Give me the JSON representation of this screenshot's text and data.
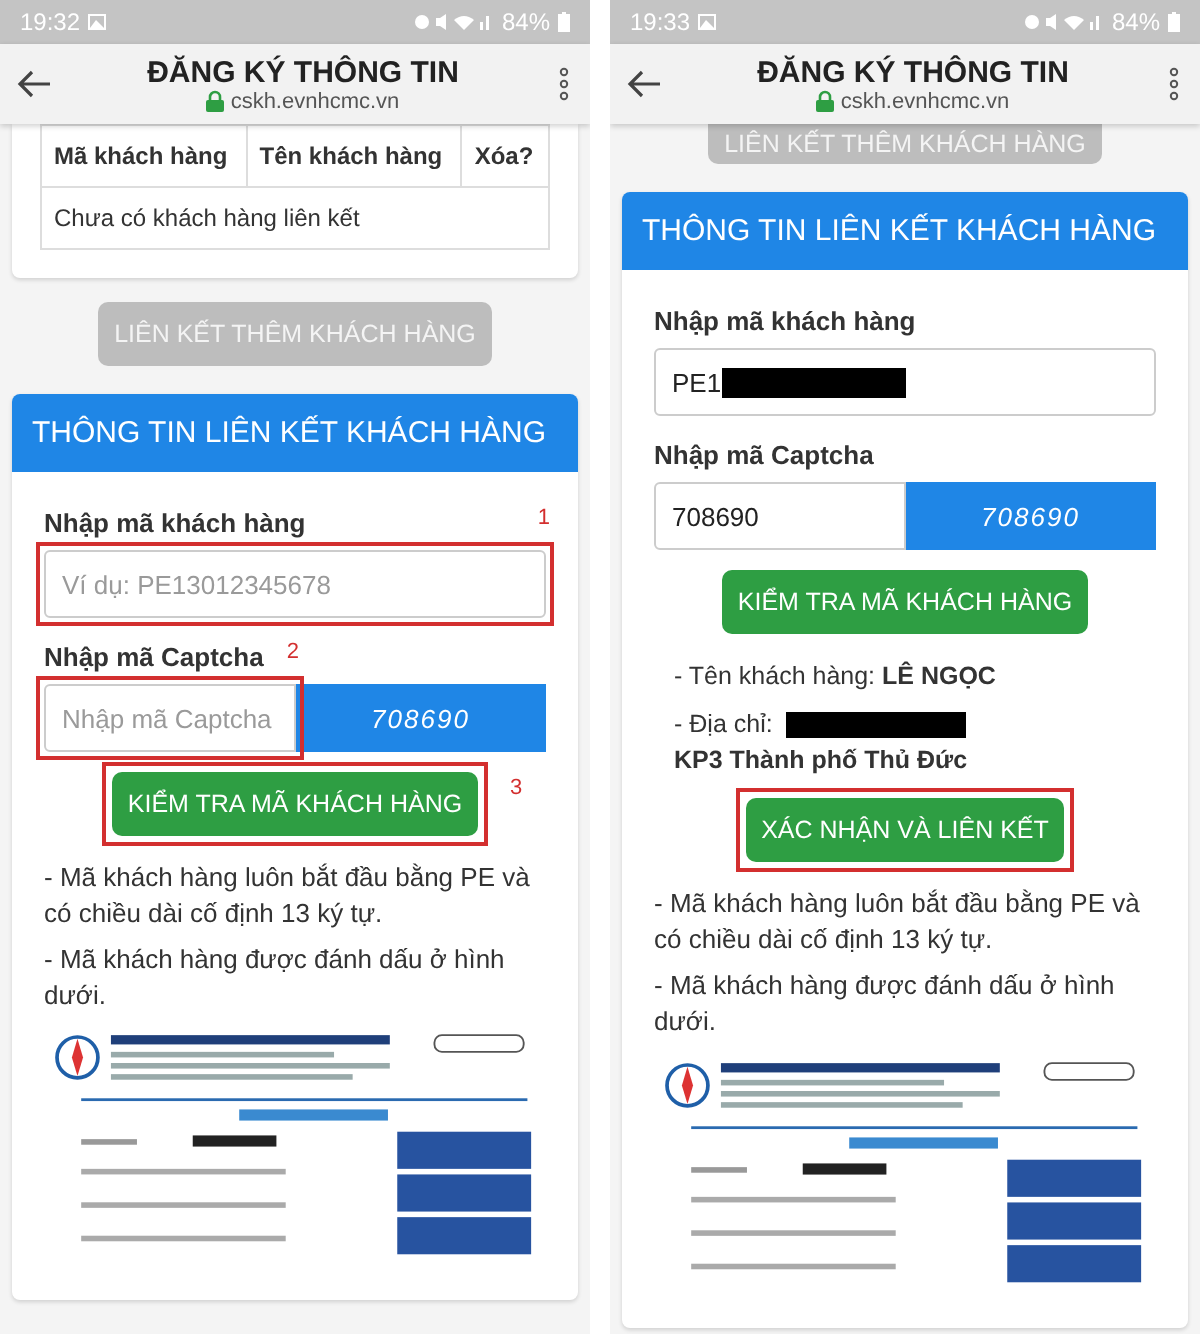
{
  "phones": [
    {
      "status_bar": {
        "time": "19:32",
        "battery": "84%"
      },
      "app_bar": {
        "title": "ĐĂNG KÝ THÔNG TIN",
        "url": "cskh.evnhcmc.vn"
      },
      "sections": [
        {
          "kind": "table",
          "columns": [
            "Mã khách hàng",
            "Tên khách hàng",
            "Xóa?"
          ],
          "empty_text": "Chưa có khách hàng liên kết"
        },
        {
          "kind": "button",
          "label": "LIÊN KẾT THÊM KHÁCH HÀNG",
          "disabled": true
        },
        {
          "kind": "card",
          "title": "THÔNG TIN LIÊN KẾT KHÁCH HÀNG",
          "items": [
            {
              "kind": "label",
              "text": "Nhập mã khách hàng"
            },
            {
              "kind": "input",
              "placeholder": "Ví dụ: PE13012345678",
              "highlighted": true,
              "mark": "1"
            },
            {
              "kind": "label",
              "text": "Nhập mã Captcha"
            },
            {
              "kind": "captcha",
              "placeholder": "Nhập mã Captcha",
              "code": "708690",
              "highlighted": true,
              "mark": "2"
            },
            {
              "kind": "button",
              "label": "KIỂM TRA MÃ KHÁCH HÀNG",
              "disabled": false,
              "highlighted": true,
              "mark": "3"
            },
            {
              "kind": "note",
              "text": "- Mã khách hàng luôn bắt đầu bằng PE và có chiều dài cố định 13 ký tự."
            },
            {
              "kind": "note",
              "text": "- Mã khách hàng được đánh dấu ở hình dưới."
            },
            {
              "kind": "picture"
            }
          ]
        }
      ]
    },
    {
      "status_bar": {
        "time": "19:33",
        "battery": "84%"
      },
      "app_bar": {
        "title": "ĐĂNG KÝ THÔNG TIN",
        "url": "cskh.evnhcmc.vn"
      },
      "sections": [
        {
          "kind": "button",
          "label": "LIÊN KẾT THÊM KHÁCH HÀNG",
          "disabled": true
        },
        {
          "kind": "card",
          "title": "THÔNG TIN LIÊN KẾT KHÁCH HÀNG",
          "items": [
            {
              "kind": "label",
              "text": "Nhập mã khách hàng"
            },
            {
              "kind": "input",
              "value": "PE1",
              "redacted": true
            },
            {
              "kind": "label",
              "text": "Nhập mã Captcha"
            },
            {
              "kind": "captcha",
              "value": "708690",
              "code": "708690"
            },
            {
              "kind": "button",
              "label": "KIỂM TRA MÃ KHÁCH HÀNG",
              "disabled": false
            },
            {
              "kind": "info",
              "label": "- Tên khách hàng:",
              "value": "LÊ NGỌC"
            },
            {
              "kind": "info",
              "label": "- Địa chỉ:",
              "redacted": true,
              "value": "KP3 Thành phố Thủ Đức"
            },
            {
              "kind": "button",
              "label": "XÁC NHẬN VÀ LIÊN KẾT",
              "disabled": false,
              "highlighted": true
            },
            {
              "kind": "note",
              "text": "- Mã khách hàng luôn bắt đầu bằng PE và có chiều dài cố định 13 ký tự."
            },
            {
              "kind": "note",
              "text": "- Mã khách hàng được đánh dấu ở hình dưới."
            },
            {
              "kind": "picture"
            }
          ]
        }
      ]
    }
  ]
}
